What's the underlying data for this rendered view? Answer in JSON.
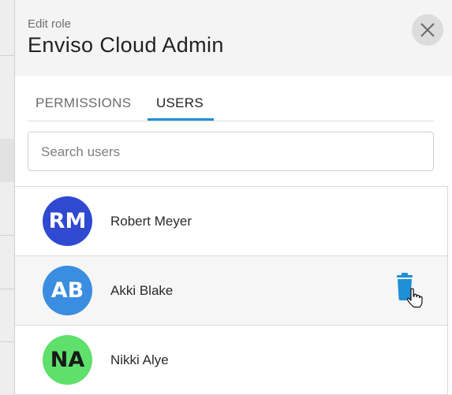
{
  "header": {
    "eyebrow": "Edit role",
    "title": "Enviso Cloud Admin"
  },
  "tabs": [
    {
      "label": "PERMISSIONS",
      "active": false
    },
    {
      "label": "USERS",
      "active": true
    }
  ],
  "search": {
    "value": "",
    "placeholder": "Search users"
  },
  "users": [
    {
      "initials": "RM",
      "name": "Robert Meyer",
      "avatar_color": "#2f4ad0",
      "initials_color": "#ffffff"
    },
    {
      "initials": "AB",
      "name": "Akki Blake",
      "avatar_color": "#3a8de0",
      "initials_color": "#ffffff"
    },
    {
      "initials": "NA",
      "name": "Nikki Alye",
      "avatar_color": "#5ee06a",
      "initials_color": "#1a1a1a"
    }
  ],
  "colors": {
    "accent": "#1f8fd6",
    "trash_icon": "#1f8fd6"
  },
  "icons": {
    "close": "close-icon",
    "delete": "trash-icon",
    "pointer": "hand-pointer-cursor"
  }
}
